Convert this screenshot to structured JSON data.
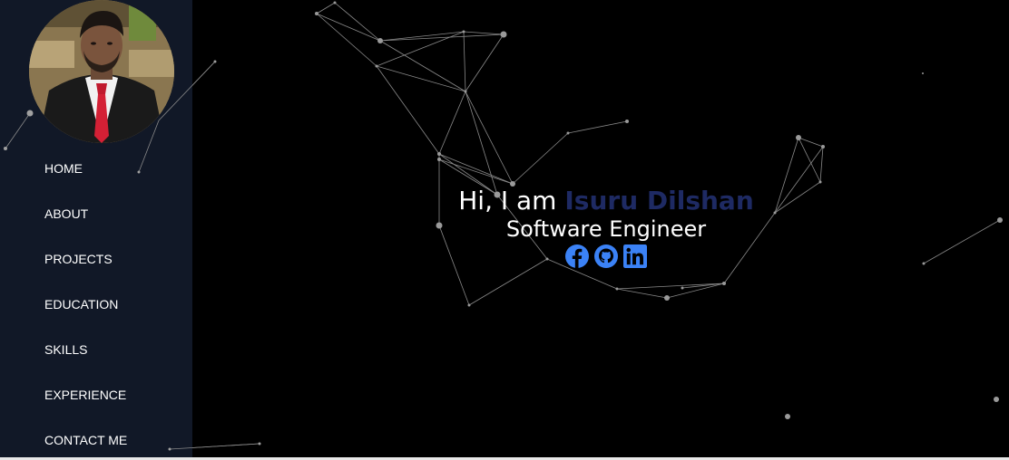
{
  "profile": {
    "avatar_icon": "profile-photo"
  },
  "nav": {
    "items": [
      {
        "label": "HOME"
      },
      {
        "label": "ABOUT"
      },
      {
        "label": "PROJECTS"
      },
      {
        "label": "EDUCATION"
      },
      {
        "label": "SKILLS"
      },
      {
        "label": "EXPERIENCE"
      },
      {
        "label": "CONTACT ME"
      }
    ]
  },
  "hero": {
    "greeting_prefix": "Hi, I am",
    "name": "Isuru Dilshan",
    "role": "Software Engineer"
  },
  "socials": [
    {
      "icon": "facebook-icon"
    },
    {
      "icon": "github-icon"
    },
    {
      "icon": "linkedin-icon"
    }
  ],
  "colors": {
    "background": "#000000",
    "sidebar": "#111827",
    "name_accent": "#1e2a63",
    "social_blue": "#3b82f6",
    "particle": "#9a9a9a"
  }
}
